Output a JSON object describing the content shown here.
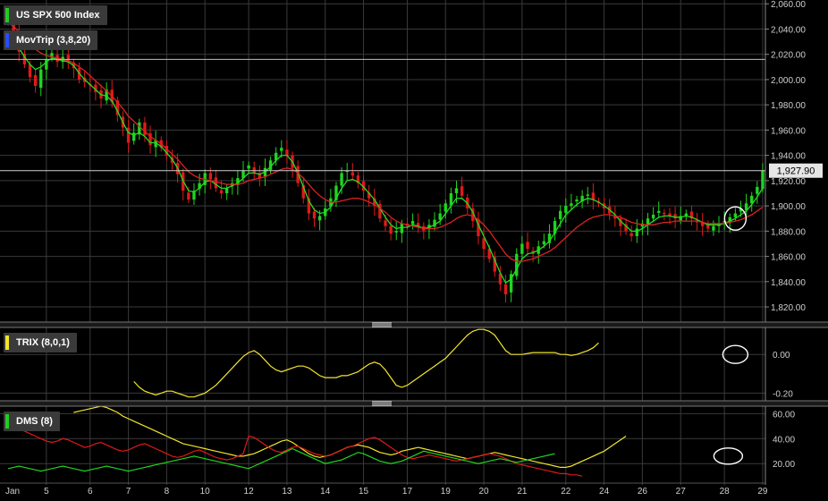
{
  "colors": {
    "background": "#000000",
    "grid": "#3a3a3a",
    "up": "#1fd61f",
    "down": "#e01919",
    "mov_green": "#22dd22",
    "mov_red": "#dd2222",
    "mov_blue": "#2d6cff",
    "trix": "#f2e52a",
    "dms_yellow": "#f2e52a",
    "dms_red": "#e01919",
    "dms_green": "#1fd61f",
    "axis_text": "#cfcfcf",
    "divider": "#777777"
  },
  "legends": {
    "main": "US SPX 500 Index",
    "movtrip": "MovTrip (3,8,20)",
    "trix": "TRIX (8,0,1)",
    "dms": "DMS (8)"
  },
  "legend_colors": {
    "main": "#22cc22",
    "movtrip": "#2a4cff",
    "trix": "#f2e52a",
    "dms": "#22cc22"
  },
  "price_label": "1,927.90",
  "chart_data": [
    {
      "type": "candlestick",
      "title": "US SPX 500 Index",
      "indicator": "MovTrip (3,8,20)",
      "x_tick_labels": [
        "Jan",
        "5",
        "6",
        "7",
        "8",
        "10",
        "12",
        "13",
        "14",
        "15",
        "17",
        "19",
        "20",
        "21",
        "22",
        "24",
        "26",
        "27",
        "28",
        "29"
      ],
      "y_ticks": [
        "1,820.00",
        "1,840.00",
        "1,860.00",
        "1,880.00",
        "1,900.00",
        "1,920.00",
        "1,940.00",
        "1,960.00",
        "1,980.00",
        "2,000.00",
        "2,020.00",
        "2,040.00",
        "2,060.00"
      ],
      "ylim": [
        1808,
        2063
      ],
      "last_price": 1927.9,
      "closes": [
        2048,
        2036,
        2022,
        2012,
        2002,
        1995,
        2008,
        2016,
        2021,
        2014,
        2018,
        2015,
        2009,
        2000,
        1998,
        1996,
        1990,
        1985,
        1992,
        1982,
        1972,
        1962,
        1950,
        1958,
        1966,
        1956,
        1948,
        1952,
        1946,
        1940,
        1934,
        1925,
        1912,
        1905,
        1912,
        1918,
        1926,
        1921,
        1914,
        1910,
        1914,
        1918,
        1922,
        1928,
        1932,
        1926,
        1922,
        1930,
        1936,
        1942,
        1946,
        1940,
        1930,
        1918,
        1906,
        1894,
        1890,
        1892,
        1898,
        1906,
        1916,
        1926,
        1928,
        1924,
        1918,
        1912,
        1906,
        1900,
        1890,
        1884,
        1878,
        1880,
        1886,
        1884,
        1888,
        1884,
        1880,
        1885,
        1889,
        1894,
        1902,
        1910,
        1914,
        1908,
        1898,
        1888,
        1876,
        1866,
        1858,
        1848,
        1838,
        1830,
        1846,
        1862,
        1870,
        1866,
        1862,
        1868,
        1872,
        1878,
        1888,
        1896,
        1900,
        1902,
        1905,
        1908,
        1909,
        1905,
        1902,
        1898,
        1894,
        1890,
        1884,
        1880,
        1876,
        1882,
        1886,
        1890,
        1893,
        1896,
        1894,
        1892,
        1890,
        1892,
        1894,
        1890,
        1887,
        1884,
        1882,
        1884,
        1886,
        1888,
        1891,
        1894,
        1898,
        1902,
        1908,
        1915,
        1927.9
      ],
      "series": [
        {
          "name": "",
          "color": "green",
          "values": [
            2038,
            2032,
            2025,
            2018,
            2012,
            2008,
            2010,
            2014,
            2017,
            2016,
            2015,
            2014,
            2011,
            2005,
            2000,
            1996,
            1992,
            1988,
            1987,
            1983,
            1975,
            1966,
            1958,
            1956,
            1958,
            1955,
            1950,
            1950,
            1947,
            1942,
            1937,
            1930,
            1920,
            1912,
            1911,
            1914,
            1919,
            1920,
            1917,
            1914,
            1914,
            1916,
            1918,
            1922,
            1926,
            1926,
            1925,
            1927,
            1931,
            1936,
            1940,
            1940,
            1935,
            1926,
            1915,
            1904,
            1897,
            1894,
            1895,
            1899,
            1906,
            1914,
            1920,
            1921,
            1919,
            1915,
            1910,
            1905,
            1898,
            1891,
            1885,
            1882,
            1883,
            1883,
            1885,
            1884,
            1882,
            1883,
            1885,
            1888,
            1894,
            1900,
            1906,
            1906,
            1902,
            1895,
            1885,
            1876,
            1867,
            1857,
            1847,
            1839,
            1842,
            1850,
            1858,
            1862,
            1863,
            1865,
            1868,
            1872,
            1879,
            1886,
            1893,
            1897,
            1901,
            1904,
            1906,
            1905,
            1903,
            1900,
            1897,
            1893,
            1888,
            1884,
            1880,
            1880,
            1882,
            1885,
            1888,
            1891,
            1892,
            1892,
            1891,
            1891,
            1892,
            1891,
            1889,
            1887,
            1885,
            1885,
            1885,
            1886,
            1888,
            1890,
            1893,
            1896,
            1901,
            1907,
            1914
          ]
        },
        {
          "name": "",
          "color": "red",
          "values": [
            2045,
            2042,
            2038,
            2033,
            2028,
            2024,
            2021,
            2019,
            2018,
            2017,
            2016,
            2015,
            2013,
            2010,
            2007,
            2003,
            1999,
            1995,
            1991,
            1987,
            1982,
            1977,
            1971,
            1967,
            1963,
            1959,
            1955,
            1952,
            1949,
            1945,
            1941,
            1937,
            1932,
            1927,
            1924,
            1922,
            1921,
            1920,
            1919,
            1918,
            1917,
            1917,
            1917,
            1918,
            1920,
            1921,
            1922,
            1923,
            1925,
            1927,
            1929,
            1930,
            1929,
            1926,
            1922,
            1917,
            1912,
            1908,
            1905,
            1903,
            1903,
            1904,
            1905,
            1906,
            1906,
            1905,
            1903,
            1901,
            1898,
            1895,
            1891,
            1888,
            1886,
            1885,
            1884,
            1883,
            1882,
            1882,
            1882,
            1883,
            1885,
            1887,
            1890,
            1892,
            1893,
            1892,
            1889,
            1885,
            1880,
            1874,
            1868,
            1862,
            1858,
            1856,
            1856,
            1857,
            1858,
            1860,
            1862,
            1864,
            1867,
            1871,
            1875,
            1879,
            1883,
            1886,
            1889,
            1891,
            1892,
            1893,
            1893,
            1892,
            1891,
            1889,
            1887,
            1886,
            1885,
            1885,
            1885,
            1886,
            1887,
            1887,
            1888,
            1888,
            1888,
            1888,
            1888,
            1887,
            1886,
            1886,
            1886,
            1886,
            1887,
            1888,
            1889,
            1891,
            1893,
            1896,
            1899
          ]
        }
      ]
    },
    {
      "type": "line",
      "title": "TRIX (8,0,1)",
      "y_ticks": [
        "-0.20",
        "0.00"
      ],
      "ylim": [
        -0.24,
        0.14
      ],
      "series": [
        {
          "name": "",
          "values": [
            null,
            null,
            null,
            null,
            null,
            null,
            null,
            null,
            null,
            null,
            null,
            null,
            null,
            null,
            null,
            null,
            null,
            null,
            null,
            null,
            null,
            null,
            null,
            -0.14,
            -0.17,
            -0.19,
            -0.2,
            -0.21,
            -0.2,
            -0.19,
            -0.19,
            -0.2,
            -0.21,
            -0.22,
            -0.22,
            -0.21,
            -0.2,
            -0.18,
            -0.16,
            -0.13,
            -0.1,
            -0.07,
            -0.04,
            -0.01,
            0.01,
            0.02,
            0.0,
            -0.03,
            -0.06,
            -0.08,
            -0.09,
            -0.08,
            -0.07,
            -0.06,
            -0.06,
            -0.07,
            -0.09,
            -0.11,
            -0.12,
            -0.12,
            -0.12,
            -0.11,
            -0.11,
            -0.1,
            -0.09,
            -0.07,
            -0.05,
            -0.04,
            -0.05,
            -0.08,
            -0.12,
            -0.16,
            -0.17,
            -0.16,
            -0.14,
            -0.12,
            -0.1,
            -0.08,
            -0.06,
            -0.04,
            -0.02,
            0.01,
            0.04,
            0.07,
            0.1,
            0.12,
            0.13,
            0.13,
            0.12,
            0.1,
            0.06,
            0.02,
            0.0,
            0.0,
            0.0,
            0.005,
            0.01,
            0.01,
            0.01,
            0.01,
            0.01,
            0.0,
            0.0,
            -0.005,
            0.0,
            0.01,
            0.02,
            0.035,
            0.06
          ]
        }
      ]
    },
    {
      "type": "line",
      "title": "DMS (8)",
      "y_ticks": [
        "20.00",
        "40.00",
        "60.00"
      ],
      "ylim": [
        8,
        66
      ],
      "series": [
        {
          "name": "",
          "color": "yellow",
          "values": [
            null,
            null,
            null,
            null,
            null,
            null,
            null,
            null,
            null,
            null,
            null,
            null,
            61,
            62,
            63,
            64,
            65,
            66,
            65,
            63,
            61,
            58,
            56,
            54,
            52,
            50,
            48,
            46,
            44,
            42,
            40,
            38,
            36,
            35,
            34,
            33,
            32,
            31,
            30,
            29,
            28,
            27,
            26,
            26,
            27,
            28,
            30,
            32,
            34,
            36,
            38,
            39,
            37,
            34,
            31,
            28,
            26,
            25,
            26,
            27,
            29,
            31,
            33,
            34,
            35,
            34,
            33,
            31,
            29,
            28,
            27,
            28,
            30,
            31,
            32,
            33,
            32,
            31,
            30,
            29,
            28,
            27,
            26,
            25,
            24,
            25,
            26,
            27,
            28,
            29,
            28,
            27,
            26,
            25,
            24,
            23,
            22,
            21,
            20,
            19,
            18,
            17,
            17,
            18,
            20,
            22,
            24,
            26,
            28,
            30,
            33,
            36,
            39,
            42
          ]
        },
        {
          "name": "",
          "color": "red",
          "values": [
            52,
            50,
            48,
            46,
            44,
            42,
            40,
            38,
            37,
            38,
            40,
            39,
            37,
            35,
            33,
            34,
            36,
            37,
            35,
            33,
            31,
            30,
            31,
            33,
            35,
            36,
            34,
            32,
            30,
            28,
            26,
            25,
            26,
            28,
            30,
            31,
            29,
            27,
            25,
            24,
            23,
            24,
            26,
            28,
            42,
            41,
            38,
            35,
            32,
            30,
            29,
            31,
            33,
            34,
            32,
            30,
            28,
            27,
            26,
            27,
            29,
            31,
            33,
            34,
            36,
            38,
            40,
            41,
            39,
            36,
            33,
            30,
            27,
            25,
            24,
            25,
            26,
            27,
            26,
            25,
            24,
            23,
            22,
            23,
            24,
            25,
            26,
            27,
            28,
            27,
            26,
            24,
            22,
            20,
            19,
            18,
            17,
            16,
            15,
            14,
            13,
            12,
            12,
            11,
            11,
            10
          ]
        },
        {
          "name": "",
          "color": "green",
          "values": [
            16,
            17,
            18,
            17,
            16,
            15,
            14,
            15,
            16,
            17,
            18,
            17,
            16,
            15,
            14,
            15,
            16,
            17,
            18,
            17,
            16,
            15,
            14,
            15,
            16,
            17,
            18,
            19,
            20,
            21,
            22,
            23,
            24,
            25,
            26,
            25,
            24,
            23,
            22,
            21,
            20,
            19,
            18,
            17,
            16,
            18,
            20,
            22,
            24,
            26,
            28,
            30,
            32,
            30,
            28,
            26,
            24,
            22,
            20,
            21,
            22,
            23,
            25,
            27,
            29,
            28,
            26,
            24,
            22,
            21,
            20,
            21,
            22,
            24,
            26,
            28,
            30,
            29,
            28,
            27,
            26,
            25,
            24,
            23,
            22,
            21,
            20,
            21,
            22,
            23,
            24,
            23,
            22,
            21,
            22,
            23,
            24,
            25,
            26,
            27,
            28
          ]
        }
      ]
    }
  ]
}
